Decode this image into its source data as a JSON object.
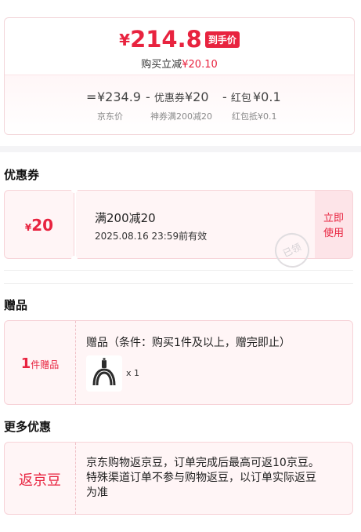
{
  "price": {
    "currency": "¥",
    "final": "214.8",
    "badge": "到手价",
    "saving_prefix": "购买立减",
    "saving_amount": "¥20.10"
  },
  "breakdown": {
    "eq": "=",
    "jd_price": "¥234.9",
    "minus1": "-",
    "coupon_label": "优惠券",
    "coupon_value": "¥20",
    "minus2": "-",
    "redpack_label": "红包",
    "redpack_value": "¥0.1",
    "labels": [
      "京东价",
      "神券满200减20",
      "红包抵¥0.1"
    ]
  },
  "coupon_section": {
    "title": "优惠券",
    "amount_symbol": "¥",
    "amount": "20",
    "name": "满200减20",
    "expiry": "2025.08.16 23:59前有效",
    "action": "立即使用",
    "stamp": "已领"
  },
  "gift_section": {
    "title": "赠品",
    "count": "1",
    "count_label": "件赠品",
    "description": "赠品（条件：购买1件及以上，赠完即止）",
    "item_icon": "cable-icon",
    "item_qty": "x 1"
  },
  "more_section": {
    "title": "更多优惠",
    "tag": "返京豆",
    "text": "京东购物返京豆，订单完成后最高可返10京豆。特殊渠道订单不参与购物返豆，以订单实际返豆为准"
  },
  "colors": {
    "accent": "#e8233f",
    "card_bg": "#fff5f6",
    "border": "#f7d3d8"
  }
}
